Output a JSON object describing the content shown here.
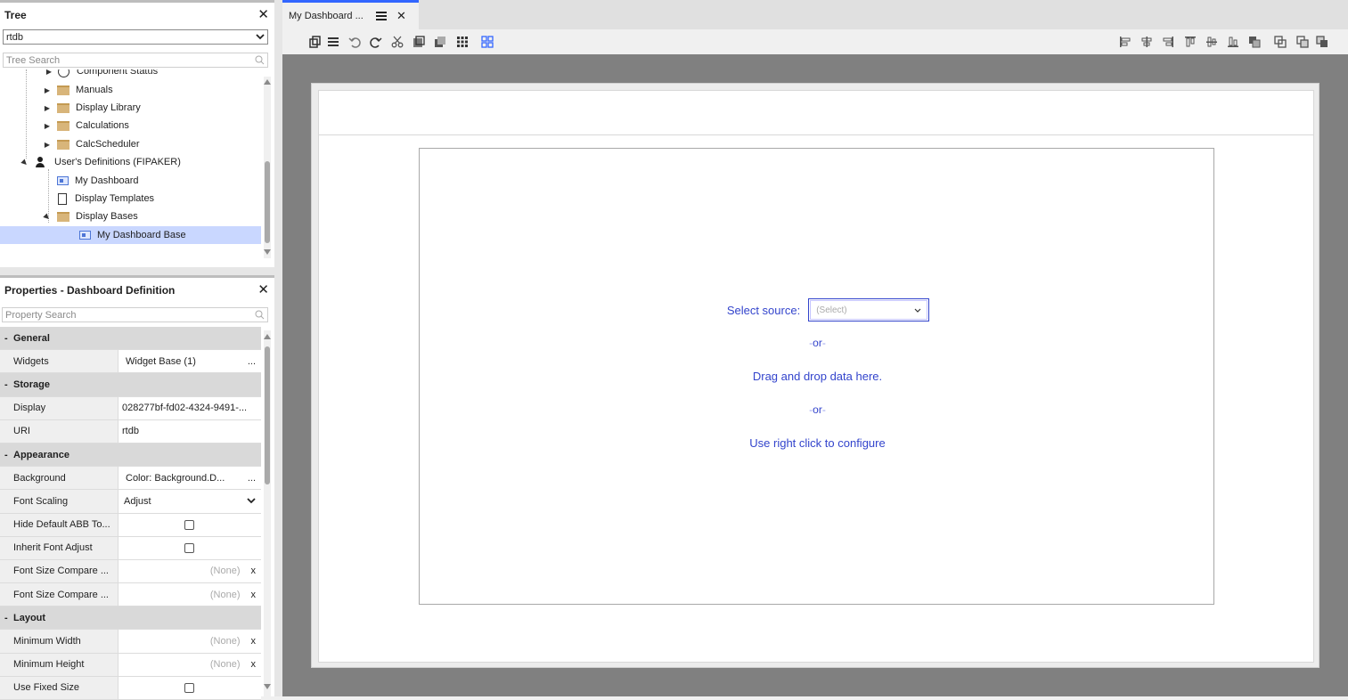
{
  "tree_panel": {
    "title": "Tree",
    "close": "✕",
    "source_select": "rtdb",
    "search_placeholder": "Tree Search",
    "items": [
      {
        "label": "Component Status",
        "indent": 1
      },
      {
        "label": "Manuals",
        "indent": 1
      },
      {
        "label": "Display Library",
        "indent": 1
      },
      {
        "label": "Calculations",
        "indent": 1
      },
      {
        "label": "CalcScheduler",
        "indent": 1
      },
      {
        "label": "User's Definitions (FIPAKER)",
        "indent": 0
      },
      {
        "label": "My Dashboard",
        "indent": 1
      },
      {
        "label": "Display Templates",
        "indent": 1
      },
      {
        "label": "Display Bases",
        "indent": 1
      },
      {
        "label": "My Dashboard Base",
        "indent": 2,
        "selected": true
      }
    ]
  },
  "props_panel": {
    "title": "Properties - Dashboard Definition",
    "close": "✕",
    "search_placeholder": "Property Search",
    "sections": {
      "general": "General",
      "storage": "Storage",
      "appearance": "Appearance",
      "layout": "Layout"
    },
    "rows": {
      "widgets": {
        "name": "Widgets",
        "value": "Widget Base (1)",
        "action": "..."
      },
      "display": {
        "name": "Display",
        "value": "028277bf-fd02-4324-9491-..."
      },
      "uri": {
        "name": "URI",
        "value": "rtdb"
      },
      "background": {
        "name": "Background",
        "value": "Color: Background.D...",
        "action": "..."
      },
      "font_scaling": {
        "name": "Font Scaling",
        "value": "Adjust"
      },
      "hide_default": {
        "name": "Hide Default ABB To...",
        "checked": false
      },
      "inherit_font": {
        "name": "Inherit Font Adjust",
        "checked": false
      },
      "font_size_1": {
        "name": "Font Size Compare ...",
        "value": "(None)",
        "clear": "x"
      },
      "font_size_2": {
        "name": "Font Size Compare ...",
        "value": "(None)",
        "clear": "x"
      },
      "min_width": {
        "name": "Minimum Width",
        "value": "(None)",
        "clear": "x"
      },
      "min_height": {
        "name": "Minimum Height",
        "value": "(None)",
        "clear": "x"
      },
      "use_fixed": {
        "name": "Use Fixed Size",
        "checked": false
      }
    },
    "section_toggle": "-"
  },
  "editor": {
    "tab_label": "My Dashboard ...",
    "tab_close": "✕",
    "widget": {
      "select_label": "Select source:",
      "select_placeholder": "(Select)",
      "or1": "or",
      "drag_text": "Drag and drop data here.",
      "or2": "or",
      "right_click_text": "Use right click to configure"
    }
  },
  "colors": {
    "accent": "#3366ff",
    "widget_text": "#3344cc",
    "selected_row": "#c9d7ff",
    "workspace": "#808080"
  }
}
